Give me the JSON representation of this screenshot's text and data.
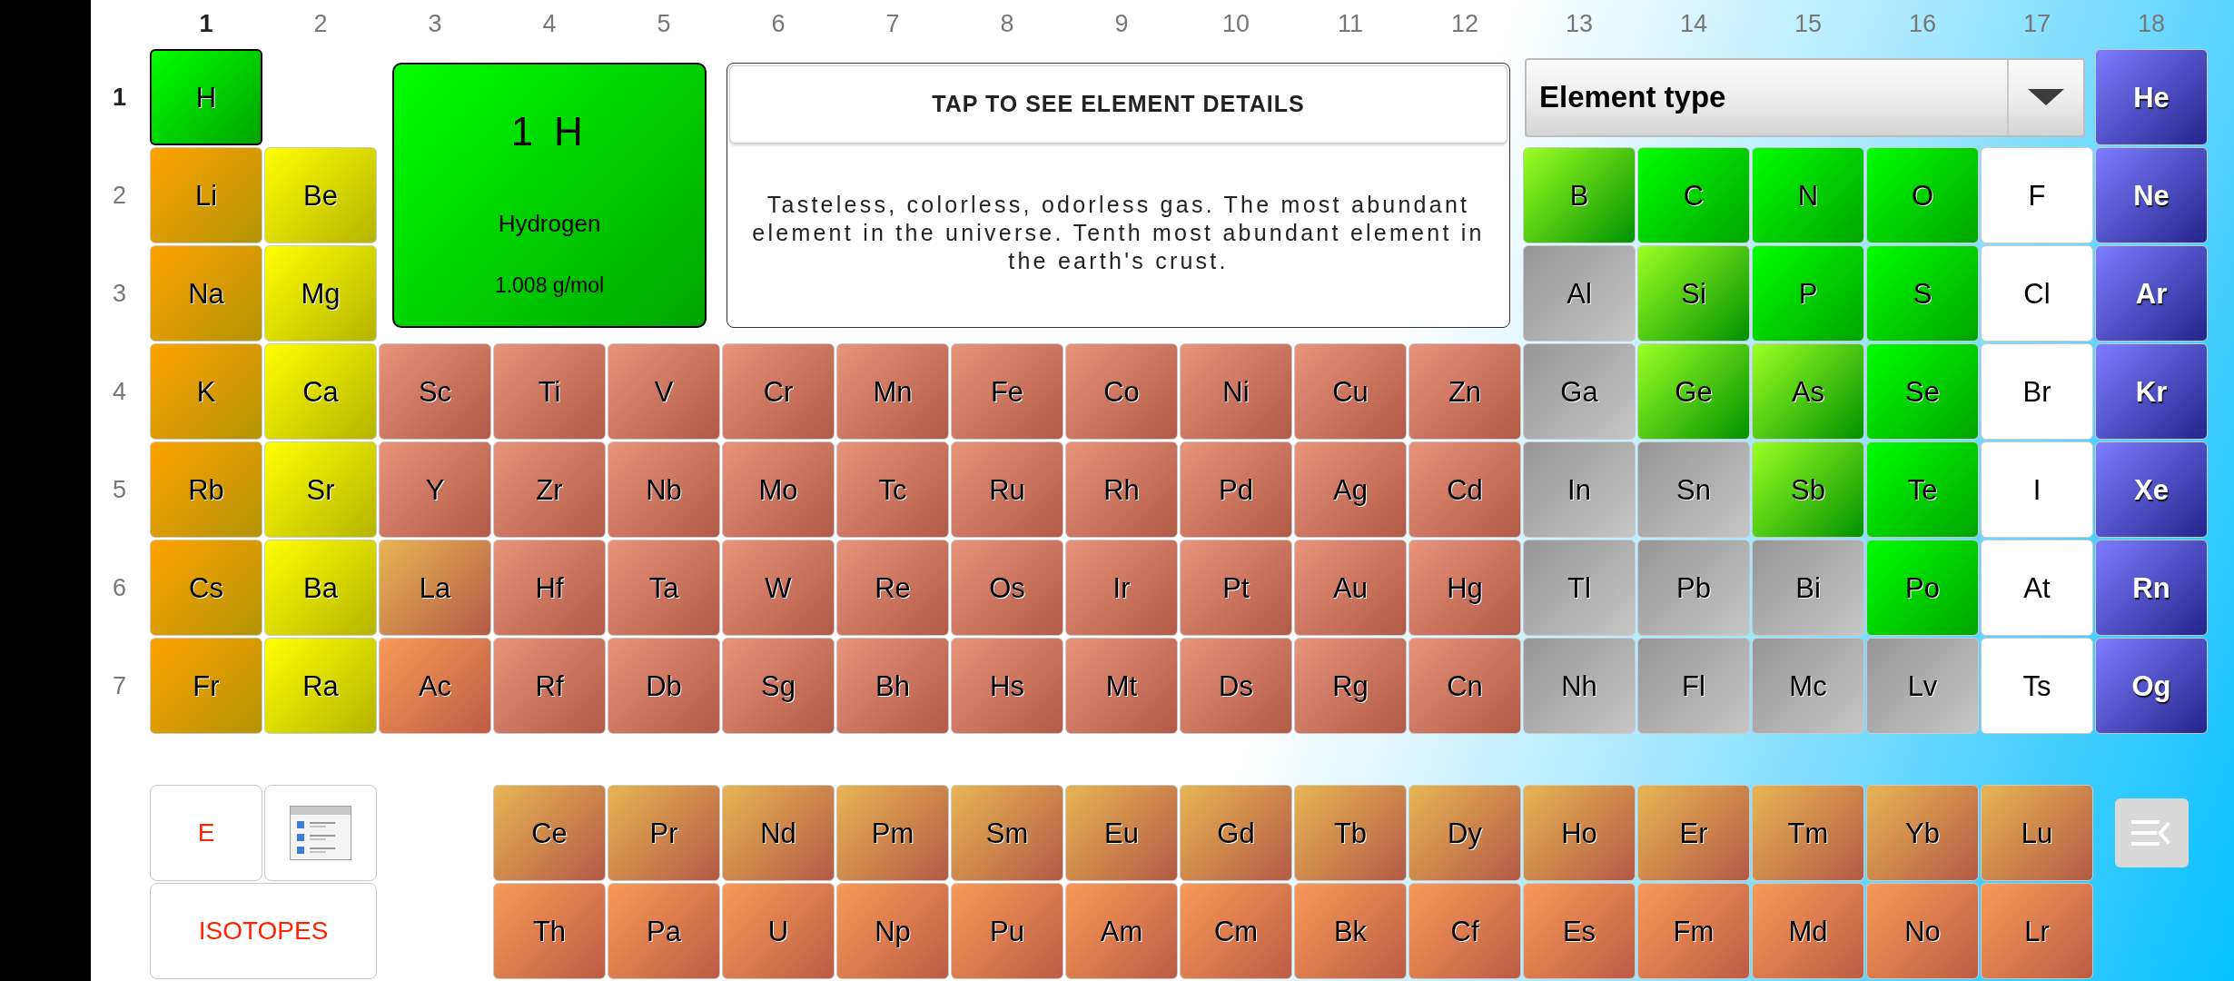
{
  "groups": [
    {
      "label": "1",
      "selected": true
    },
    {
      "label": "2",
      "selected": false
    },
    {
      "label": "3",
      "selected": false
    },
    {
      "label": "4",
      "selected": false
    },
    {
      "label": "5",
      "selected": false
    },
    {
      "label": "6",
      "selected": false
    },
    {
      "label": "7",
      "selected": false
    },
    {
      "label": "8",
      "selected": false
    },
    {
      "label": "9",
      "selected": false
    },
    {
      "label": "10",
      "selected": false
    },
    {
      "label": "11",
      "selected": false
    },
    {
      "label": "12",
      "selected": false
    },
    {
      "label": "13",
      "selected": false
    },
    {
      "label": "14",
      "selected": false
    },
    {
      "label": "15",
      "selected": false
    },
    {
      "label": "16",
      "selected": false
    },
    {
      "label": "17",
      "selected": false
    },
    {
      "label": "18",
      "selected": false
    }
  ],
  "periods": [
    {
      "label": "1",
      "selected": true,
      "left": [
        {
          "symbol": "H",
          "kind": "nonmetal",
          "selected": true
        }
      ],
      "right": [
        {
          "symbol": "He",
          "kind": "noble",
          "selected": false
        }
      ]
    },
    {
      "label": "2",
      "selected": false,
      "left": [
        {
          "symbol": "Li",
          "kind": "alkali",
          "selected": false
        },
        {
          "symbol": "Be",
          "kind": "alkaline",
          "selected": false
        }
      ],
      "right": [
        {
          "symbol": "B",
          "kind": "metalloid",
          "selected": false
        },
        {
          "symbol": "C",
          "kind": "nonmetal",
          "selected": false
        },
        {
          "symbol": "N",
          "kind": "nonmetal",
          "selected": false
        },
        {
          "symbol": "O",
          "kind": "nonmetal",
          "selected": false
        },
        {
          "symbol": "F",
          "kind": "halogen",
          "selected": false
        },
        {
          "symbol": "Ne",
          "kind": "noble",
          "selected": false
        }
      ]
    },
    {
      "label": "3",
      "selected": false,
      "left": [
        {
          "symbol": "Na",
          "kind": "alkali",
          "selected": false
        },
        {
          "symbol": "Mg",
          "kind": "alkaline",
          "selected": false
        }
      ],
      "right": [
        {
          "symbol": "Al",
          "kind": "posttransition",
          "selected": false
        },
        {
          "symbol": "Si",
          "kind": "metalloid",
          "selected": false
        },
        {
          "symbol": "P",
          "kind": "nonmetal",
          "selected": false
        },
        {
          "symbol": "S",
          "kind": "nonmetal",
          "selected": false
        },
        {
          "symbol": "Cl",
          "kind": "halogen",
          "selected": false
        },
        {
          "symbol": "Ar",
          "kind": "noble",
          "selected": false
        }
      ]
    },
    {
      "label": "4",
      "selected": false,
      "left": [
        {
          "symbol": "K",
          "kind": "alkali",
          "selected": false
        },
        {
          "symbol": "Ca",
          "kind": "alkaline",
          "selected": false
        }
      ],
      "right": [
        {
          "symbol": "Sc",
          "kind": "transition",
          "selected": false
        },
        {
          "symbol": "Ti",
          "kind": "transition",
          "selected": false
        },
        {
          "symbol": "V",
          "kind": "transition",
          "selected": false
        },
        {
          "symbol": "Cr",
          "kind": "transition",
          "selected": false
        },
        {
          "symbol": "Mn",
          "kind": "transition",
          "selected": false
        },
        {
          "symbol": "Fe",
          "kind": "transition",
          "selected": false
        },
        {
          "symbol": "Co",
          "kind": "transition",
          "selected": false
        },
        {
          "symbol": "Ni",
          "kind": "transition",
          "selected": false
        },
        {
          "symbol": "Cu",
          "kind": "transition",
          "selected": false
        },
        {
          "symbol": "Zn",
          "kind": "transition",
          "selected": false
        },
        {
          "symbol": "Ga",
          "kind": "posttransition",
          "selected": false
        },
        {
          "symbol": "Ge",
          "kind": "metalloid",
          "selected": false
        },
        {
          "symbol": "As",
          "kind": "metalloid",
          "selected": false
        },
        {
          "symbol": "Se",
          "kind": "nonmetal",
          "selected": false
        },
        {
          "symbol": "Br",
          "kind": "halogen",
          "selected": false
        },
        {
          "symbol": "Kr",
          "kind": "noble",
          "selected": false
        }
      ]
    },
    {
      "label": "5",
      "selected": false,
      "left": [
        {
          "symbol": "Rb",
          "kind": "alkali",
          "selected": false
        },
        {
          "symbol": "Sr",
          "kind": "alkaline",
          "selected": false
        }
      ],
      "right": [
        {
          "symbol": "Y",
          "kind": "transition",
          "selected": false
        },
        {
          "symbol": "Zr",
          "kind": "transition",
          "selected": false
        },
        {
          "symbol": "Nb",
          "kind": "transition",
          "selected": false
        },
        {
          "symbol": "Mo",
          "kind": "transition",
          "selected": false
        },
        {
          "symbol": "Tc",
          "kind": "transition",
          "selected": false
        },
        {
          "symbol": "Ru",
          "kind": "transition",
          "selected": false
        },
        {
          "symbol": "Rh",
          "kind": "transition",
          "selected": false
        },
        {
          "symbol": "Pd",
          "kind": "transition",
          "selected": false
        },
        {
          "symbol": "Ag",
          "kind": "transition",
          "selected": false
        },
        {
          "symbol": "Cd",
          "kind": "transition",
          "selected": false
        },
        {
          "symbol": "In",
          "kind": "posttransition",
          "selected": false
        },
        {
          "symbol": "Sn",
          "kind": "posttransition",
          "selected": false
        },
        {
          "symbol": "Sb",
          "kind": "metalloid",
          "selected": false
        },
        {
          "symbol": "Te",
          "kind": "nonmetal",
          "selected": false
        },
        {
          "symbol": "I",
          "kind": "halogen",
          "selected": false
        },
        {
          "symbol": "Xe",
          "kind": "noble",
          "selected": false
        }
      ]
    },
    {
      "label": "6",
      "selected": false,
      "left": [
        {
          "symbol": "Cs",
          "kind": "alkali",
          "selected": false
        },
        {
          "symbol": "Ba",
          "kind": "alkaline",
          "selected": false
        }
      ],
      "right": [
        {
          "symbol": "La",
          "kind": "lanthanide",
          "selected": false
        },
        {
          "symbol": "Hf",
          "kind": "transition",
          "selected": false
        },
        {
          "symbol": "Ta",
          "kind": "transition",
          "selected": false
        },
        {
          "symbol": "W",
          "kind": "transition",
          "selected": false
        },
        {
          "symbol": "Re",
          "kind": "transition",
          "selected": false
        },
        {
          "symbol": "Os",
          "kind": "transition",
          "selected": false
        },
        {
          "symbol": "Ir",
          "kind": "transition",
          "selected": false
        },
        {
          "symbol": "Pt",
          "kind": "transition",
          "selected": false
        },
        {
          "symbol": "Au",
          "kind": "transition",
          "selected": false
        },
        {
          "symbol": "Hg",
          "kind": "transition",
          "selected": false
        },
        {
          "symbol": "Tl",
          "kind": "posttransition",
          "selected": false
        },
        {
          "symbol": "Pb",
          "kind": "posttransition",
          "selected": false
        },
        {
          "symbol": "Bi",
          "kind": "posttransition",
          "selected": false
        },
        {
          "symbol": "Po",
          "kind": "nonmetal",
          "selected": false
        },
        {
          "symbol": "At",
          "kind": "halogen",
          "selected": false
        },
        {
          "symbol": "Rn",
          "kind": "noble",
          "selected": false
        }
      ]
    },
    {
      "label": "7",
      "selected": false,
      "left": [
        {
          "symbol": "Fr",
          "kind": "alkali",
          "selected": false
        },
        {
          "symbol": "Ra",
          "kind": "alkaline",
          "selected": false
        }
      ],
      "right": [
        {
          "symbol": "Ac",
          "kind": "actinide",
          "selected": false
        },
        {
          "symbol": "Rf",
          "kind": "transition",
          "selected": false
        },
        {
          "symbol": "Db",
          "kind": "transition",
          "selected": false
        },
        {
          "symbol": "Sg",
          "kind": "transition",
          "selected": false
        },
        {
          "symbol": "Bh",
          "kind": "transition",
          "selected": false
        },
        {
          "symbol": "Hs",
          "kind": "transition",
          "selected": false
        },
        {
          "symbol": "Mt",
          "kind": "transition",
          "selected": false
        },
        {
          "symbol": "Ds",
          "kind": "transition",
          "selected": false
        },
        {
          "symbol": "Rg",
          "kind": "transition",
          "selected": false
        },
        {
          "symbol": "Cn",
          "kind": "transition",
          "selected": false
        },
        {
          "symbol": "Nh",
          "kind": "posttransition",
          "selected": false
        },
        {
          "symbol": "Fl",
          "kind": "posttransition",
          "selected": false
        },
        {
          "symbol": "Mc",
          "kind": "posttransition",
          "selected": false
        },
        {
          "symbol": "Lv",
          "kind": "posttransition",
          "selected": false
        },
        {
          "symbol": "Ts",
          "kind": "halogen",
          "selected": false
        },
        {
          "symbol": "Og",
          "kind": "noble",
          "selected": false
        }
      ]
    }
  ],
  "details": {
    "heading": "1 H",
    "name": "Hydrogen",
    "mass": "1.008 g/mol",
    "kind": "nonmetal"
  },
  "info": {
    "button": "TAP TO SEE ELEMENT DETAILS",
    "description": "Tasteless, colorless, odorless gas. The most abundant element in the universe. Tenth most abundant element in the earth's crust."
  },
  "type_dropdown": {
    "value": "Element type"
  },
  "lanthanides": [
    {
      "symbol": "Ce",
      "kind": "lanthanide",
      "selected": false
    },
    {
      "symbol": "Pr",
      "kind": "lanthanide",
      "selected": false
    },
    {
      "symbol": "Nd",
      "kind": "lanthanide",
      "selected": false
    },
    {
      "symbol": "Pm",
      "kind": "lanthanide",
      "selected": false
    },
    {
      "symbol": "Sm",
      "kind": "lanthanide",
      "selected": false
    },
    {
      "symbol": "Eu",
      "kind": "lanthanide",
      "selected": false
    },
    {
      "symbol": "Gd",
      "kind": "lanthanide",
      "selected": false
    },
    {
      "symbol": "Tb",
      "kind": "lanthanide",
      "selected": false
    },
    {
      "symbol": "Dy",
      "kind": "lanthanide",
      "selected": false
    },
    {
      "symbol": "Ho",
      "kind": "lanthanide",
      "selected": false
    },
    {
      "symbol": "Er",
      "kind": "lanthanide",
      "selected": false
    },
    {
      "symbol": "Tm",
      "kind": "lanthanide",
      "selected": false
    },
    {
      "symbol": "Yb",
      "kind": "lanthanide",
      "selected": false
    },
    {
      "symbol": "Lu",
      "kind": "lanthanide",
      "selected": false
    }
  ],
  "actinides": [
    {
      "symbol": "Th",
      "kind": "actinide",
      "selected": false
    },
    {
      "symbol": "Pa",
      "kind": "actinide",
      "selected": false
    },
    {
      "symbol": "U",
      "kind": "actinide",
      "selected": false
    },
    {
      "symbol": "Np",
      "kind": "actinide",
      "selected": false
    },
    {
      "symbol": "Pu",
      "kind": "actinide",
      "selected": false
    },
    {
      "symbol": "Am",
      "kind": "actinide",
      "selected": false
    },
    {
      "symbol": "Cm",
      "kind": "actinide",
      "selected": false
    },
    {
      "symbol": "Bk",
      "kind": "actinide",
      "selected": false
    },
    {
      "symbol": "Cf",
      "kind": "actinide",
      "selected": false
    },
    {
      "symbol": "Es",
      "kind": "actinide",
      "selected": false
    },
    {
      "symbol": "Fm",
      "kind": "actinide",
      "selected": false
    },
    {
      "symbol": "Md",
      "kind": "actinide",
      "selected": false
    },
    {
      "symbol": "No",
      "kind": "actinide",
      "selected": false
    },
    {
      "symbol": "Lr",
      "kind": "actinide",
      "selected": false
    }
  ],
  "tools": {
    "e_button": "E",
    "isotopes_button": "ISOTOPES"
  }
}
